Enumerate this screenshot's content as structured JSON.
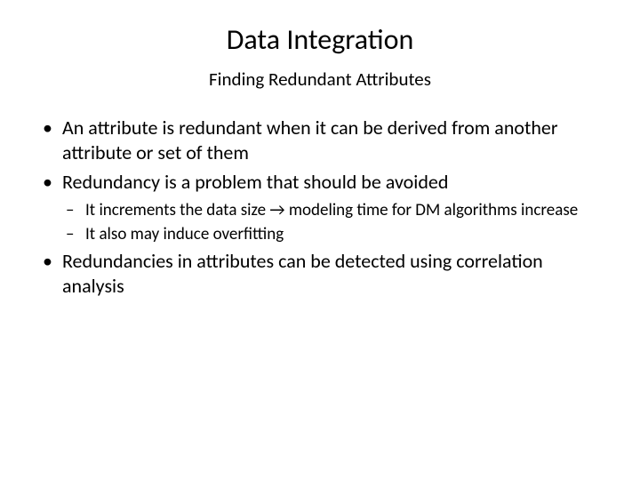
{
  "title": "Data Integration",
  "subtitle": "Finding Redundant Attributes",
  "bullets": [
    "An attribute is redundant when it can be derived from another attribute or set of them",
    "Redundancy is a problem that should be avoided"
  ],
  "sub_bullets": [
    "It increments the data size → modeling time for DM algorithms increase",
    "It also may induce overfitting"
  ],
  "bullets_after": [
    "Redundancies in attributes can be detected using correlation analysis"
  ]
}
